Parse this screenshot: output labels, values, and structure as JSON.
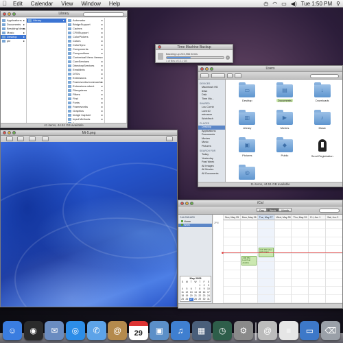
{
  "menubar": {
    "apple": "",
    "items": [
      "Edit",
      "Calendar",
      "View",
      "Window",
      "Help"
    ],
    "status_icons": [
      "wifi-icon",
      "display-icon",
      "volume-icon"
    ],
    "clock": "Tue 1:50 PM"
  },
  "library_window": {
    "title": "Library",
    "status": "41 items, 44.51 GB available",
    "col1": [
      "Applications",
      "Documents",
      "Breaking News",
      "Music",
      "Desktop",
      "ple"
    ],
    "col2": [
      "Library",
      "",
      "",
      "",
      "",
      "",
      "",
      "",
      "",
      "",
      "",
      "",
      "",
      "",
      "",
      "",
      "",
      "",
      "",
      "",
      "",
      "",
      "",
      "",
      ""
    ],
    "col3": [
      "Automator",
      "BridgeSupport",
      "Caches",
      "CFMSupport",
      "ColorPickers",
      "Colors",
      "ColorSync",
      "Components",
      "Compositions",
      "Contextual Menu Items",
      "CoreServices",
      "DirectoryServices",
      "Emaildnts",
      "DTDs",
      "Extensions",
      "Frameworks.bonecache",
      "Extensions.mkext",
      "Filesystems",
      "Filters",
      "Find",
      "Fonts",
      "Frameworks",
      "Graphics",
      "Image Capture",
      "Input Methods",
      "Java",
      "Kerberos Plugins",
      "Keyboard Layouts",
      "Keychains"
    ]
  },
  "timemachine": {
    "title": "Time Machine Backup",
    "status": "Backing up 203,956 items",
    "sub": "1 of files of 13.1 GB",
    "progress": 0.42
  },
  "finder_window": {
    "title": "Users",
    "status": "11 items, 44.51 GB available",
    "sidebar": [
      {
        "type": "hdr",
        "label": "DEVICES"
      },
      {
        "type": "item",
        "label": "Macintosh HD"
      },
      {
        "type": "item",
        "label": "iDisk"
      },
      {
        "type": "item",
        "label": "Disk"
      },
      {
        "type": "item",
        "label": "Time Ma..."
      },
      {
        "type": "hdr",
        "label": "SHARED"
      },
      {
        "type": "item",
        "label": "Lou Cornb"
      },
      {
        "type": "item",
        "label": "Lone10"
      },
      {
        "type": "item",
        "label": "ertmaxer"
      },
      {
        "type": "item",
        "label": "Workfinch"
      },
      {
        "type": "hdr",
        "label": "PLACES"
      },
      {
        "type": "item",
        "label": "Desktop",
        "sel": true
      },
      {
        "type": "item",
        "label": "Applications"
      },
      {
        "type": "item",
        "label": "Documents"
      },
      {
        "type": "item",
        "label": "Movies"
      },
      {
        "type": "item",
        "label": "Music"
      },
      {
        "type": "item",
        "label": "Pictures"
      },
      {
        "type": "hdr",
        "label": "SEARCH FOR"
      },
      {
        "type": "item",
        "label": "Today"
      },
      {
        "type": "item",
        "label": "Yesterday"
      },
      {
        "type": "item",
        "label": "Past Week"
      },
      {
        "type": "item",
        "label": "All Images"
      },
      {
        "type": "item",
        "label": "All Movies"
      },
      {
        "type": "item",
        "label": "All Documents"
      }
    ],
    "items": [
      {
        "label": "Desktop",
        "glyph": "▭",
        "hl": false
      },
      {
        "label": "Documents",
        "glyph": "▤",
        "hl": true
      },
      {
        "label": "Downloads",
        "glyph": "↓",
        "hl": false
      },
      {
        "label": "Library",
        "glyph": "▥",
        "hl": false
      },
      {
        "label": "Movies",
        "glyph": "▶",
        "hl": false
      },
      {
        "label": "Music",
        "glyph": "♪",
        "hl": false
      },
      {
        "label": "Pictures",
        "glyph": "▣",
        "hl": false
      },
      {
        "label": "Public",
        "glyph": "◆",
        "hl": false
      },
      {
        "label": "Send Registration",
        "glyph": "",
        "hl": false
      },
      {
        "label": "Sites",
        "glyph": "◎",
        "hl": false
      }
    ]
  },
  "preview_window": {
    "title": "Mt-5.png",
    "toolbar": [
      "Move",
      "Select",
      "Zoom",
      "Slideshow"
    ],
    "toolbar_right": "Sidebar"
  },
  "ical_window": {
    "title": "iCal",
    "segments": [
      "Day",
      "Week",
      "Month"
    ],
    "active_segment": "Week",
    "sidebar_header": "CALENDARS",
    "calendars": [
      "Home",
      "Work"
    ],
    "days": [
      "Sun, May 25",
      "Mon, May 26",
      "Tue, May 27",
      "Wed, May 28",
      "Thu, May 29",
      "Fri, Jun 1",
      "Sat, Jun 2"
    ],
    "today_index": 2,
    "hours": [
      "2PM",
      "",
      "",
      "",
      "",
      "",
      "",
      "",
      "",
      "",
      "",
      ""
    ],
    "events": [
      {
        "day": 1,
        "text": "4:00 PM Lunch at Anish's"
      },
      {
        "day": 2,
        "text": "4:00 PM Meet with Craig"
      }
    ],
    "mini_month": "May 2008",
    "mini_days_hdr": [
      "S",
      "M",
      "T",
      "W",
      "T",
      "F",
      "S"
    ],
    "mini_days": [
      "",
      "",
      "",
      "",
      "1",
      "2",
      "3",
      "4",
      "5",
      "6",
      "7",
      "8",
      "9",
      "10",
      "11",
      "12",
      "13",
      "14",
      "15",
      "16",
      "17",
      "18",
      "19",
      "20",
      "21",
      "22",
      "23",
      "24",
      "25",
      "26",
      "27",
      "28",
      "29",
      "30",
      "31"
    ],
    "mini_today": "27"
  },
  "dock": {
    "items": [
      {
        "name": "finder-icon",
        "color": "#3a7de0",
        "glyph": "☺"
      },
      {
        "name": "dashboard-icon",
        "color": "#2b2b2b",
        "glyph": "◉"
      },
      {
        "name": "mail-icon",
        "color": "#6a8cc0",
        "glyph": "✉"
      },
      {
        "name": "safari-icon",
        "color": "#2c8de8",
        "glyph": "◎"
      },
      {
        "name": "ichat-icon",
        "color": "#5da3e8",
        "glyph": "✆"
      },
      {
        "name": "address-book-icon",
        "color": "#b48a4d",
        "glyph": "@"
      },
      {
        "name": "ical-icon",
        "color": "#ffffff",
        "glyph": "29"
      },
      {
        "name": "preview-icon",
        "color": "#5b8fc8",
        "glyph": "▣"
      },
      {
        "name": "itunes-icon",
        "color": "#3f7fd0",
        "glyph": "♫"
      },
      {
        "name": "spaces-icon",
        "color": "#4a5f7a",
        "glyph": "▦"
      },
      {
        "name": "time-machine-icon",
        "color": "#2e5e4a",
        "glyph": "◷"
      },
      {
        "name": "system-preferences-icon",
        "color": "#8a8a8a",
        "glyph": "⚙"
      },
      {
        "name": "sep",
        "color": "",
        "glyph": ""
      },
      {
        "name": "downloads-stack-icon",
        "color": "#bcbcbc",
        "glyph": "@"
      },
      {
        "name": "document-stack-icon",
        "color": "#e6e6e6",
        "glyph": "≡"
      },
      {
        "name": "screen-stack-icon",
        "color": "#3d78c8",
        "glyph": "▭"
      },
      {
        "name": "trash-icon",
        "color": "#9aa0a8",
        "glyph": "⌫"
      }
    ]
  }
}
